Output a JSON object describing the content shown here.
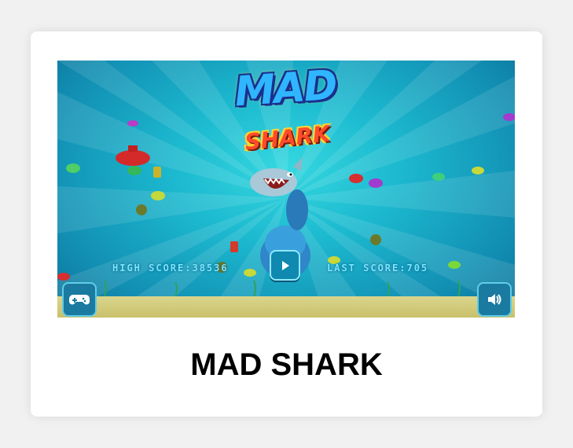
{
  "game": {
    "logo_line1": "MAD",
    "logo_line2": "SHARK",
    "high_score_text": "HIGH SCORE:38536",
    "last_score_text": "LAST SCORE:705",
    "play_icon": "play-icon",
    "gamepad_icon": "gamepad-icon",
    "sound_icon": "speaker-icon"
  },
  "card": {
    "title": "MAD SHARK"
  }
}
